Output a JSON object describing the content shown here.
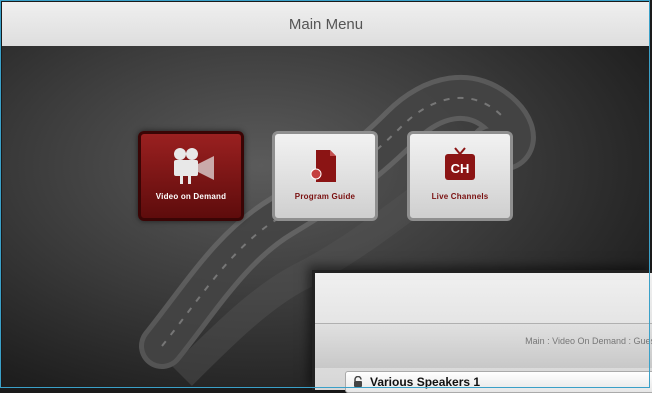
{
  "header": {
    "title": "Main Menu"
  },
  "menu": {
    "items": [
      {
        "label": "Video on Demand",
        "icon": "movie-camera-icon",
        "selected": true
      },
      {
        "label": "Program Guide",
        "icon": "document-icon",
        "selected": false
      },
      {
        "label": "Live Channels",
        "icon": "tv-ch-icon",
        "icon_text": "CH",
        "selected": false
      }
    ]
  },
  "subpanel": {
    "breadcrumb": "Main : Video On Demand : Gues",
    "row_label": "Various Speakers 1",
    "row_icon": "lock-icon"
  },
  "colors": {
    "accent_red": "#8b1414",
    "frame_blue": "#3aa0c8"
  }
}
